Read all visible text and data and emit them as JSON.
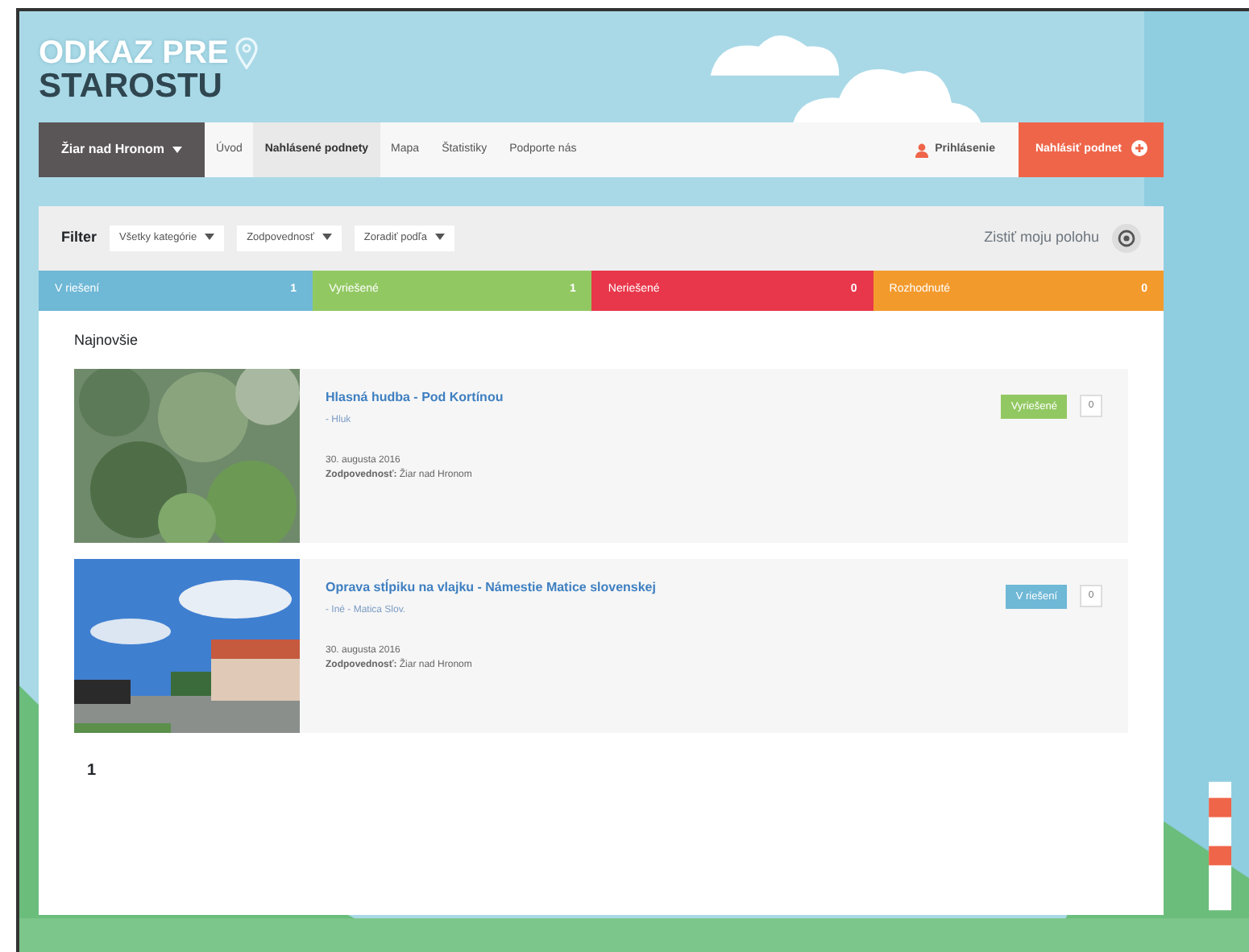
{
  "logo": {
    "line_1": "ODKAZ PRE",
    "line_2": "STAROSTU"
  },
  "nav": {
    "city": "Žiar nad Hronom",
    "tabs": [
      {
        "label": "Úvod",
        "selected": false
      },
      {
        "label": "Nahlásené podnety",
        "selected": true
      },
      {
        "label": "Mapa",
        "selected": false
      },
      {
        "label": "Štatistiky",
        "selected": false
      },
      {
        "label": "Podporte nás",
        "selected": false
      }
    ],
    "login": "Prihlásenie",
    "report_button": "Nahlásiť podnet"
  },
  "filter": {
    "label": "Filter",
    "dropdowns": [
      "Všetky kategórie",
      "Zodpovednosť",
      "Zoradiť podľa"
    ],
    "location": "Zistiť moju polohu"
  },
  "status_tabs": [
    {
      "label": "V riešení",
      "count": "1",
      "color": "#6fb8d6"
    },
    {
      "label": "Vyriešené",
      "count": "1",
      "color": "#92c862"
    },
    {
      "label": "Neriešené",
      "count": "0",
      "color": "#e8364a"
    },
    {
      "label": "Rozhodnuté",
      "count": "0",
      "color": "#f39a2c"
    }
  ],
  "section_title": "Najnovšie",
  "items": [
    {
      "title": "Hlasná hudba - Pod Kortínou",
      "category": "- Hluk",
      "date": "30. augusta 2016",
      "responsibility_label": "Zodpovednosť:",
      "responsibility": "Žiar nad Hronom",
      "badge": {
        "label": "Vyriešené",
        "color": "#92c862"
      },
      "comments": "0"
    },
    {
      "title": "Oprava stĺpiku na vlajku - Námestie Matice slovenskej",
      "category": "- Iné - Matica Slov.",
      "date": "30. augusta 2016",
      "responsibility_label": "Zodpovednosť:",
      "responsibility": "Žiar nad Hronom",
      "badge": {
        "label": "V riešení",
        "color": "#6fb8d6"
      },
      "comments": "0"
    }
  ],
  "pagination": [
    "1"
  ]
}
